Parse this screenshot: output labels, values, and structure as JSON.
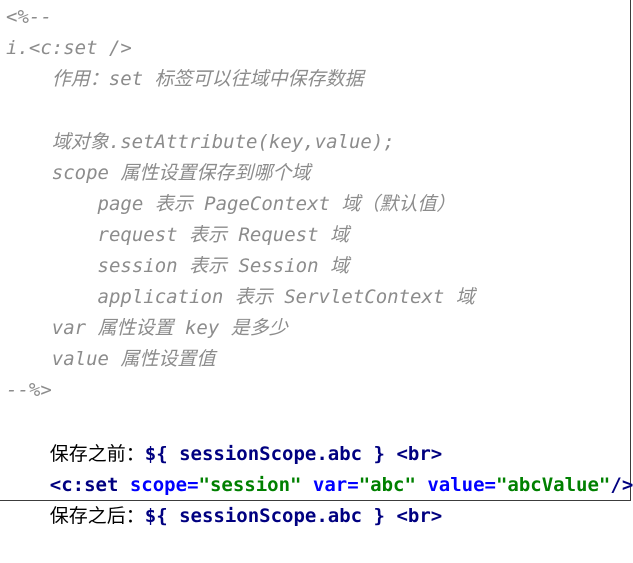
{
  "comment_lines": [
    "<%--",
    "i.<c:set />",
    "    作用：set 标签可以往域中保存数据",
    "",
    "    域对象.setAttribute(key,value);",
    "    scope 属性设置保存到哪个域",
    "        page 表示 PageContext 域（默认值）",
    "        request 表示 Request 域",
    "        session 表示 Session 域",
    "        application 表示 ServletContext 域",
    "    var 属性设置 key 是多少",
    "    value 属性设置值",
    "--%>"
  ],
  "line_before": {
    "prefix": "保存之前：",
    "el": "${ sessionScope.abc }",
    "space": " ",
    "tag": "<br>"
  },
  "line_set": {
    "open": "<",
    "tagname": "c:set",
    "a1_name": " scope",
    "eq": "=",
    "a1_val": "\"session\"",
    "a2_name": " var",
    "a2_val": "\"abc\"",
    "a3_name": " value",
    "a3_val": "\"abcValue\"",
    "close": "/>"
  },
  "line_after": {
    "prefix": "保存之后：",
    "el": "${ sessionScope.abc }",
    "space": " ",
    "tag": "<br>"
  },
  "colors": {
    "comment": "#8c8c8c",
    "tag": "#000080",
    "attribute": "#0000ff",
    "string": "#008000",
    "text": "#000000"
  }
}
